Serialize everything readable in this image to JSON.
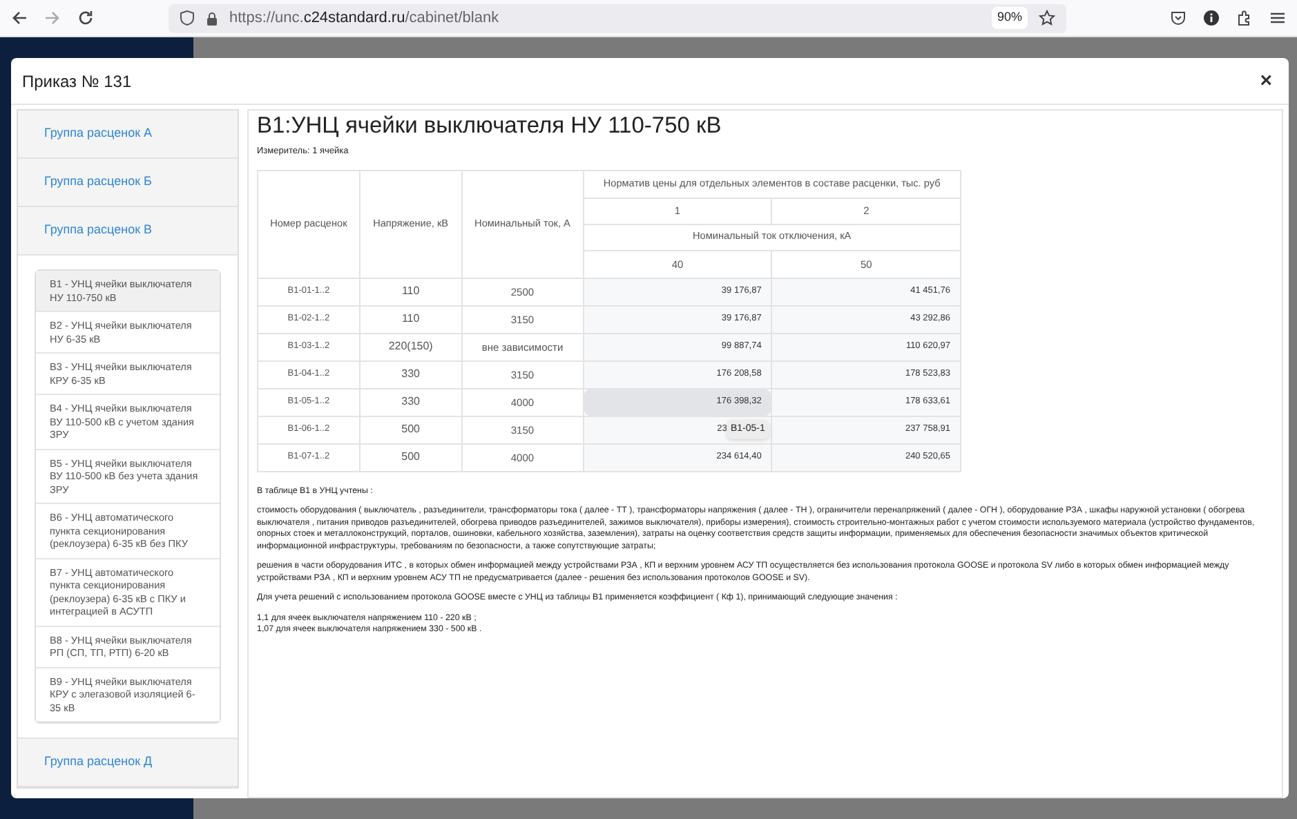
{
  "browser": {
    "url_prefix": "https://unc.",
    "url_domain": "c24standard.ru",
    "url_path": "/cabinet/blank",
    "zoom": "90%"
  },
  "modal": {
    "title": "Приказ № 131",
    "close": "×"
  },
  "sidebar": {
    "groups": [
      {
        "label": "Группа расценок А"
      },
      {
        "label": "Группа расценок Б"
      },
      {
        "label": "Группа расценок В",
        "children": [
          {
            "label": "В1 - УНЦ ячейки выключателя НУ 110-750 кВ",
            "selected": true
          },
          {
            "label": "В2 - УНЦ ячейки выключателя НУ 6-35 кВ",
            "selected": false
          },
          {
            "label": "В3 - УНЦ ячейки выключателя КРУ 6-35 кВ",
            "selected": false
          },
          {
            "label": "В4 - УНЦ ячейки выключателя ВУ 110-500 кВ с учетом здания ЗРУ",
            "selected": false
          },
          {
            "label": "В5 - УНЦ ячейки выключателя ВУ 110-500 кВ без учета здания ЗРУ",
            "selected": false
          },
          {
            "label": "В6 - УНЦ автоматического пункта секционирования (реклоузера) 6-35 кВ без ПКУ",
            "selected": false
          },
          {
            "label": "В7 - УНЦ автоматического пункта секционирования (реклоузера) 6-35 кВ с ПКУ и интеграцией в АСУТП",
            "selected": false
          },
          {
            "label": "В8 - УНЦ ячейки выключателя РП (СП, ТП, РТП) 6-20 кВ",
            "selected": false
          },
          {
            "label": "В9 - УНЦ ячейки выключателя КРУ с элегазовой изоляцией 6-35 кВ",
            "selected": false
          }
        ]
      },
      {
        "label": "Группа расценок Д"
      }
    ]
  },
  "content": {
    "title": "В1:УНЦ ячейки выключателя НУ 110-750 кВ",
    "unit": "Измеритель: 1 ячейка",
    "table": {
      "columns": [
        "Номер расценок",
        "Напряжение, кВ",
        "Номинальный ток, А"
      ],
      "group_header": "Норматив цены для отдельных элементов в составе расценки, тыс. руб",
      "element_numbers": [
        "1",
        "2"
      ],
      "sub_header": "Номинальный ток отключения, кА",
      "currents": [
        "40",
        "50"
      ],
      "rows": [
        {
          "code": "В1-01-1..2",
          "voltage": "110",
          "current": "2500",
          "prices": [
            {
              "value": "39 176,87",
              "selected": false
            },
            {
              "value": "41 451,76",
              "selected": false
            }
          ]
        },
        {
          "code": "В1-02-1..2",
          "voltage": "110",
          "current": "3150",
          "prices": [
            {
              "value": "39 176,87",
              "selected": false
            },
            {
              "value": "43 292,86",
              "selected": false
            }
          ]
        },
        {
          "code": "В1-03-1..2",
          "voltage": "220(150)",
          "current": "вне зависимости",
          "prices": [
            {
              "value": "99 887,74",
              "selected": false
            },
            {
              "value": "110 620,97",
              "selected": false
            }
          ]
        },
        {
          "code": "В1-04-1..2",
          "voltage": "330",
          "current": "3150",
          "prices": [
            {
              "value": "176 208,58",
              "selected": false
            },
            {
              "value": "178 523,83",
              "selected": false
            }
          ]
        },
        {
          "code": "В1-05-1..2",
          "voltage": "330",
          "current": "4000",
          "prices": [
            {
              "value": "176 398,32",
              "selected": true
            },
            {
              "value": "178 633,61",
              "selected": false
            }
          ]
        },
        {
          "code": "В1-06-1..2",
          "voltage": "500",
          "current": "3150",
          "prices": [
            {
              "value": "23",
              "selected": false,
              "tooltip": "В1-05-1"
            },
            {
              "value": "237 758,91",
              "selected": false
            }
          ]
        },
        {
          "code": "В1-07-1..2",
          "voltage": "500",
          "current": "4000",
          "prices": [
            {
              "value": "234 614,40",
              "selected": false
            },
            {
              "value": "240 520,65",
              "selected": false
            }
          ]
        }
      ]
    },
    "notes": [
      "В таблице В1 в УНЦ учтены :",
      "стоимость оборудования ( выключатель , разъединители, трансформаторы тока ( далее - ТТ ), трансформаторы напряжения ( далее - ТН ), ограничители перенапряжений ( далее - ОГН ), оборудование РЗА , шкафы наружной установки ( обогрева выключателя , питания приводов разъединителей, обогрева приводов разъединителей, зажимов выключателя), приборы измерения), стоимость строительно-монтажных работ с учетом стоимости используемого материала (устройство фундаментов, опорных стоек и металлоконструкций, порталов, ошиновки, кабельного хозяйства, заземления), затраты на оценку соответствия средств защиты информации, применяемых для обеспечения безопасности значимых объектов критической информационной инфраструктуры, требованиям по безопасности, а также сопутствующие затраты;",
      "решения в части оборудования ИТС , в которых обмен информацией между устройствами РЗА , КП и верхним уровнем АСУ ТП осуществляется без использования протокола GOOSE и протокола SV либо в которых обмен информацией между устройствами РЗА , КП и верхним уровнем АСУ ТП не предусматривается (далее - решения без использования протоколов GOOSE и SV).",
      "Для учета решений с использованием протокола GOOSE вместе с УНЦ из таблицы В1 применяется коэффициент ( Кф 1), принимающий следующие значения :"
    ],
    "coefficients": [
      "1,1 для ячеек выключателя напряжением 110 - 220 кВ ;",
      "1,07 для ячеек выключателя напряжением 330 - 500 кВ ."
    ]
  }
}
